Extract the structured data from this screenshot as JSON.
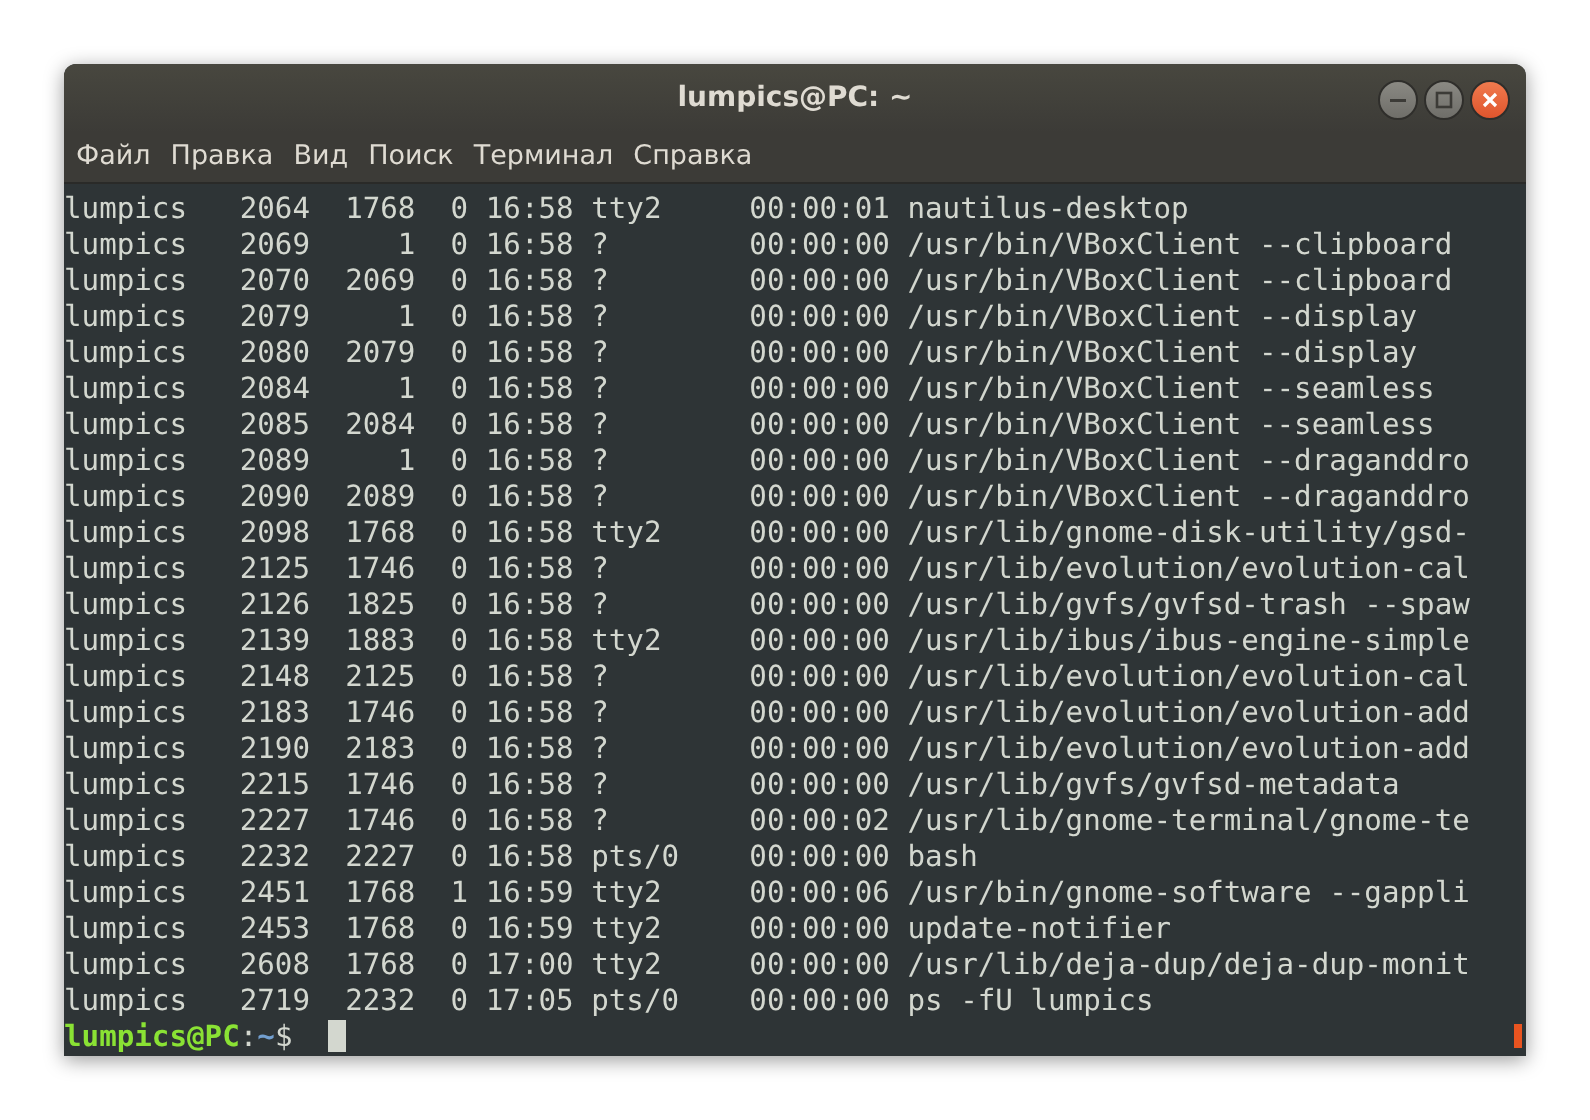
{
  "window": {
    "title": "lumpics@PC: ~"
  },
  "menu": [
    "Файл",
    "Правка",
    "Вид",
    "Поиск",
    "Терминал",
    "Справка"
  ],
  "lines": [
    "lumpics   2064  1768  0 16:58 tty2     00:00:01 nautilus-desktop",
    "lumpics   2069     1  0 16:58 ?        00:00:00 /usr/bin/VBoxClient --clipboard",
    "lumpics   2070  2069  0 16:58 ?        00:00:00 /usr/bin/VBoxClient --clipboard",
    "lumpics   2079     1  0 16:58 ?        00:00:00 /usr/bin/VBoxClient --display",
    "lumpics   2080  2079  0 16:58 ?        00:00:00 /usr/bin/VBoxClient --display",
    "lumpics   2084     1  0 16:58 ?        00:00:00 /usr/bin/VBoxClient --seamless",
    "lumpics   2085  2084  0 16:58 ?        00:00:00 /usr/bin/VBoxClient --seamless",
    "lumpics   2089     1  0 16:58 ?        00:00:00 /usr/bin/VBoxClient --draganddro",
    "lumpics   2090  2089  0 16:58 ?        00:00:00 /usr/bin/VBoxClient --draganddro",
    "lumpics   2098  1768  0 16:58 tty2     00:00:00 /usr/lib/gnome-disk-utility/gsd-",
    "lumpics   2125  1746  0 16:58 ?        00:00:00 /usr/lib/evolution/evolution-cal",
    "lumpics   2126  1825  0 16:58 ?        00:00:00 /usr/lib/gvfs/gvfsd-trash --spaw",
    "lumpics   2139  1883  0 16:58 tty2     00:00:00 /usr/lib/ibus/ibus-engine-simple",
    "lumpics   2148  2125  0 16:58 ?        00:00:00 /usr/lib/evolution/evolution-cal",
    "lumpics   2183  1746  0 16:58 ?        00:00:00 /usr/lib/evolution/evolution-add",
    "lumpics   2190  2183  0 16:58 ?        00:00:00 /usr/lib/evolution/evolution-add",
    "lumpics   2215  1746  0 16:58 ?        00:00:00 /usr/lib/gvfs/gvfsd-metadata",
    "lumpics   2227  1746  0 16:58 ?        00:00:02 /usr/lib/gnome-terminal/gnome-te",
    "lumpics   2232  2227  0 16:58 pts/0    00:00:00 bash",
    "lumpics   2451  1768  1 16:59 tty2     00:00:06 /usr/bin/gnome-software --gappli",
    "lumpics   2453  1768  0 16:59 tty2     00:00:00 update-notifier",
    "lumpics   2608  1768  0 17:00 tty2     00:00:00 /usr/lib/deja-dup/deja-dup-monit",
    "lumpics   2719  2232  0 17:05 pts/0    00:00:00 ps -fU lumpics"
  ],
  "prompt": {
    "user_host": "lumpics@PC",
    "separator": ":",
    "path": "~",
    "symbol": "$"
  }
}
